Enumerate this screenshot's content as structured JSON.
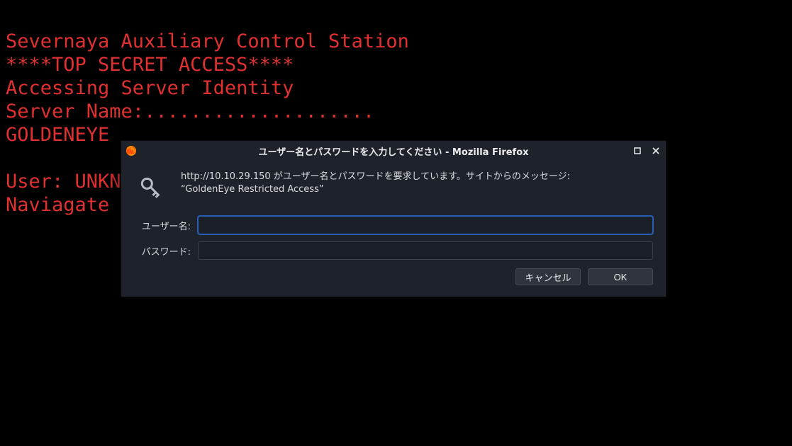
{
  "terminal": {
    "line1": "Severnaya Auxiliary Control Station",
    "line2": "****TOP SECRET ACCESS****",
    "line3": "Accessing Server Identity",
    "line4": "Server Name:....................",
    "line5": "GOLDENEYE",
    "line6": "",
    "line7": "User: UNKN",
    "line8": "Naviagate "
  },
  "dialog": {
    "title": "ユーザー名とパスワードを入力してください - Mozilla Firefox",
    "message_line1": "http://10.10.29.150 がユーザー名とパスワードを要求しています。サイトからのメッセージ:",
    "message_line2": "“GoldenEye Restricted Access”",
    "username_label": "ユーザー名:",
    "password_label": "パスワード:",
    "username_value": "",
    "password_value": "",
    "cancel_label": "キャンセル",
    "ok_label": "OK"
  },
  "icons": {
    "firefox": "firefox-icon",
    "key": "key-icon",
    "maximize": "maximize-icon",
    "close": "close-icon"
  }
}
